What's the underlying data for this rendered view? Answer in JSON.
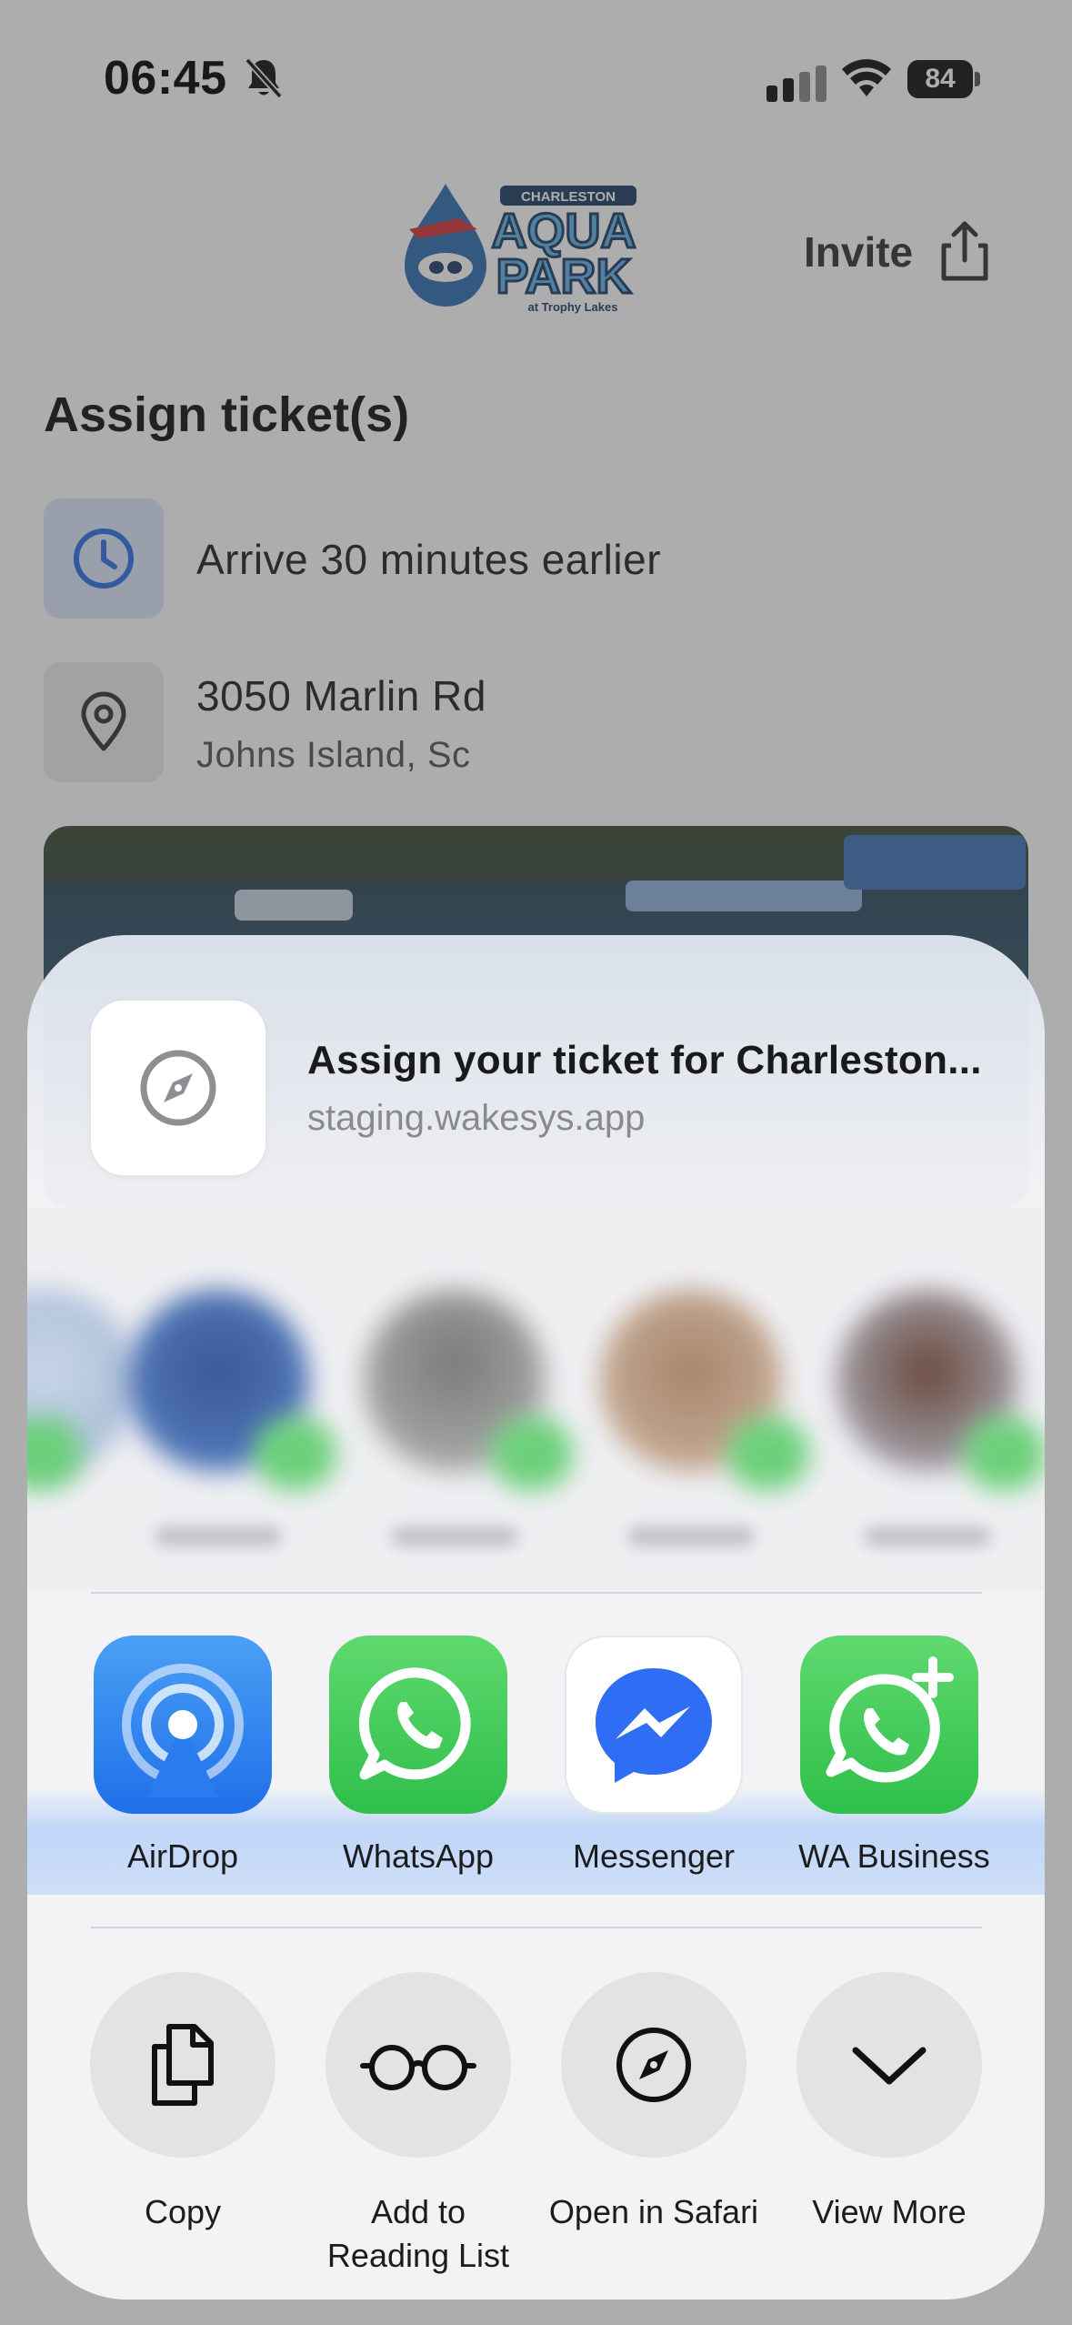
{
  "status_bar": {
    "time": "06:45",
    "battery": "84"
  },
  "header": {
    "logo_alt": "Charleston Aqua Park at Trophy Lakes",
    "invite_label": "Invite"
  },
  "page": {
    "title": "Assign ticket(s)",
    "arrival_note": "Arrive 30 minutes earlier",
    "address_line1": "3050 Marlin Rd",
    "address_line2": "Johns Island, Sc"
  },
  "share_sheet": {
    "link_title": "Assign your ticket for Charleston...",
    "link_url": "staging.wakesys.app",
    "apps": [
      {
        "label": "AirDrop",
        "icon": "airdrop-icon"
      },
      {
        "label": "WhatsApp",
        "icon": "whatsapp-icon"
      },
      {
        "label": "Messenger",
        "icon": "messenger-icon"
      },
      {
        "label": "WA Business",
        "icon": "whatsapp-business-icon"
      }
    ],
    "actions": [
      {
        "label": "Copy",
        "icon": "copy-icon"
      },
      {
        "label": "Add to\nReading List",
        "icon": "reading-glasses-icon"
      },
      {
        "label": "Open in Safari",
        "icon": "compass-icon"
      },
      {
        "label": "View More",
        "icon": "chevron-down-icon"
      }
    ]
  },
  "colors": {
    "accent_blue": "#2d6fe6",
    "whatsapp_green": "#48c95f",
    "sheet_bg": "#f6f6f8"
  }
}
